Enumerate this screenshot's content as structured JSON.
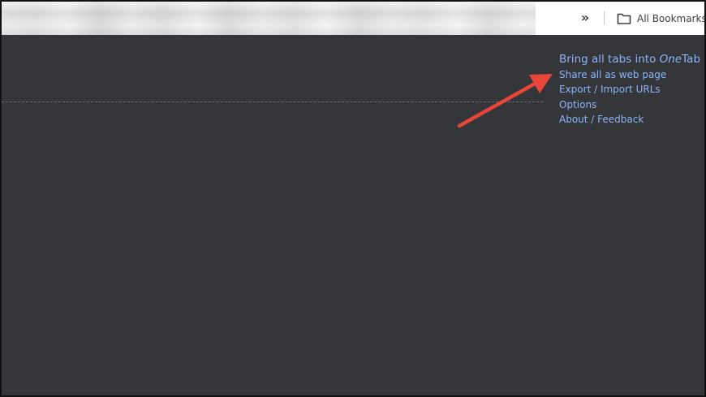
{
  "bookmarks_bar": {
    "overflow_icon": "double-chevron-right",
    "all_bookmarks_label": "All Bookmarks",
    "folder_icon": "folder-outline"
  },
  "onetab_menu": {
    "bring_all_prefix": "Bring all tabs into ",
    "bring_all_brand_italic": "One",
    "bring_all_brand_rest": "Tab",
    "share_all": "Share all as web page",
    "export_import": "Export / Import URLs",
    "options": "Options",
    "about_feedback": "About / Feedback"
  },
  "colors": {
    "page_background": "#35363a",
    "link": "#8ab4f8",
    "annotation_arrow": "#e8463a",
    "bookmarks_bar_background": "#ffffff"
  }
}
